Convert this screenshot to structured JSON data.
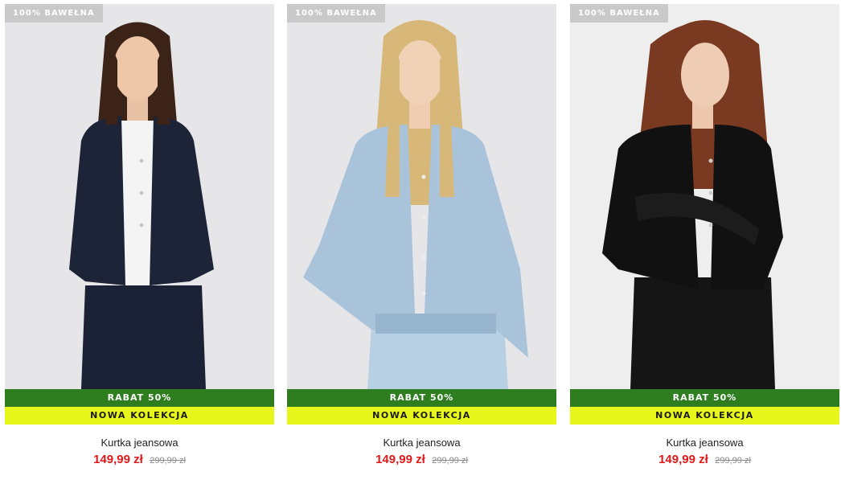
{
  "products": [
    {
      "badge": "100% BAWEŁNA",
      "promo": "RABAT 50%",
      "collection": "NOWA KOLEKCJA",
      "name": "Kurtka jeansowa",
      "price_now": "149,99 zł",
      "price_old": "299,99 zł",
      "jacket_color": "#1d2438",
      "hair_color": "#3b2417"
    },
    {
      "badge": "100% BAWEŁNA",
      "promo": "RABAT 50%",
      "collection": "NOWA KOLEKCJA",
      "name": "Kurtka jeansowa",
      "price_now": "149,99 zł",
      "price_old": "299,99 zł",
      "jacket_color": "#a9c3db",
      "hair_color": "#d8b878"
    },
    {
      "badge": "100% BAWEŁNA",
      "promo": "RABAT 50%",
      "collection": "NOWA KOLEKCJA",
      "name": "Kurtka jeansowa",
      "price_now": "149,99 zł",
      "price_old": "299,99 zł",
      "jacket_color": "#111111",
      "hair_color": "#7a3a22"
    }
  ],
  "colors": {
    "promo_bg": "#2e7d1e",
    "collection_bg": "#e8f71b",
    "badge_bg": "#c9c9c9",
    "price_now": "#e01a1a",
    "price_old": "#8a8a8a"
  }
}
